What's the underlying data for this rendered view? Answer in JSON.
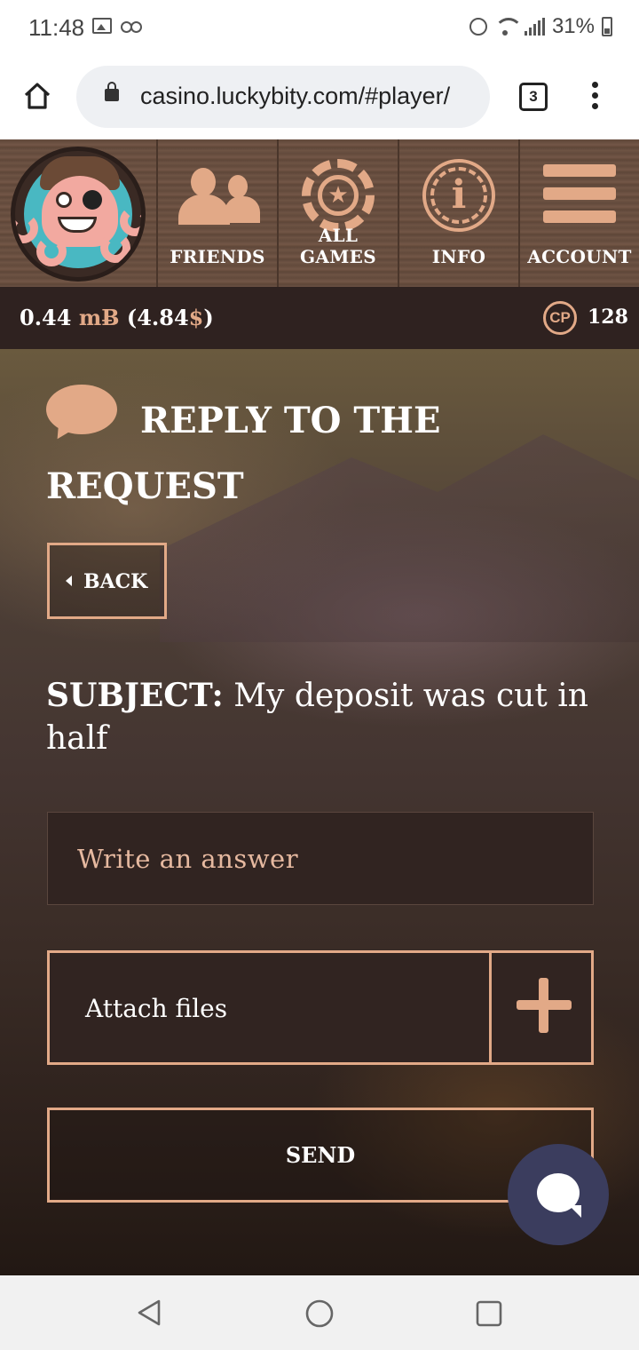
{
  "status_bar": {
    "time": "11:48",
    "battery": "31%"
  },
  "browser": {
    "url": "casino.luckybity.com/#player/",
    "tab_count": "3"
  },
  "nav": {
    "items": [
      {
        "label": "FRIENDS",
        "icon": "friends-icon"
      },
      {
        "label": "ALL GAMES",
        "icon": "casino-chip-icon"
      },
      {
        "label": "INFO",
        "icon": "info-icon"
      },
      {
        "label": "ACCOUNT",
        "icon": "hamburger-menu-icon"
      }
    ]
  },
  "balance": {
    "amount": "0.44",
    "unit": "mɃ",
    "usd_open": "(4.84",
    "usd_symbol": "$",
    "usd_close": ")",
    "cp_label": "CP",
    "cp_value": "128"
  },
  "page": {
    "title": "REPLY TO THE REQUEST",
    "back_label": "BACK",
    "subject_label": "SUBJECT:",
    "subject_text": " My deposit was cut in half",
    "answer_placeholder": "Write an answer",
    "attach_label": "Attach files",
    "send_label": "SEND"
  },
  "colors": {
    "accent": "#e2a987",
    "panel": "#312421",
    "bar": "#2f2220",
    "chat": "#3b3d5e"
  }
}
